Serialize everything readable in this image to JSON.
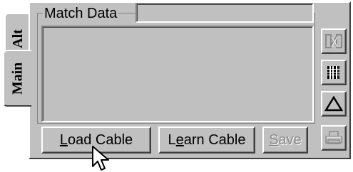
{
  "tabs": [
    {
      "label": "Alt"
    },
    {
      "label": "Main",
      "active": true
    }
  ],
  "group": {
    "title": "Match Data",
    "name_value": ""
  },
  "buttons": {
    "load": {
      "accel": "L",
      "rest": "oad Cable"
    },
    "learn": {
      "pre": "L",
      "accel": "e",
      "rest": "arn Cable"
    },
    "save": {
      "accel": "S",
      "rest": "ave",
      "enabled": false
    }
  },
  "side_icons": [
    "match-compare-icon",
    "barcode-list-icon",
    "delta-triangle-icon",
    "printer-icon"
  ],
  "cursor": "arrow-pointer-icon"
}
